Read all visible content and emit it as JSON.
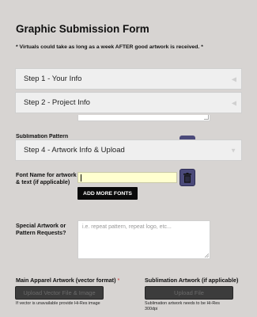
{
  "form": {
    "title": "Graphic Submission Form",
    "subtitle": "* Virtuals could take as long as a week AFTER good artwork is received. *"
  },
  "steps": [
    {
      "label": "Step 1 - Your Info",
      "state": "collapsed"
    },
    {
      "label": "Step 2 - Project Info",
      "state": "collapsed"
    },
    {
      "label": "Step 4 - Artwork Info & Upload",
      "state": "expanded"
    }
  ],
  "partial_label": "Sublimation Pattern",
  "font_field": {
    "label": "Font Name for artwork & text (if applicable)",
    "value": "",
    "add_button": "ADD MORE FONTS",
    "trash_icon": "trash-icon"
  },
  "special_field": {
    "label": "Special Artwork or Pattern Requests?",
    "placeholder": "i.e. repeat pattern, repeat logo, etc..."
  },
  "uploads": {
    "main": {
      "label": "Main Apparel Artwork (vector format)",
      "required_mark": "*",
      "button": "Upload Vector File & Image",
      "help": "If vector is unavailable provide Hi-Res image"
    },
    "sublimation": {
      "label": "Sublimation Artwork (if applicable)",
      "button": "Upload File",
      "help": "Sublimation artwork needs to be Hi-Res 300dpi"
    }
  },
  "colors": {
    "background": "#d7d4d2",
    "input_highlight": "#ffffcf",
    "trash_button": "#4b4a7a",
    "upload_button": "#3c3c3c"
  }
}
